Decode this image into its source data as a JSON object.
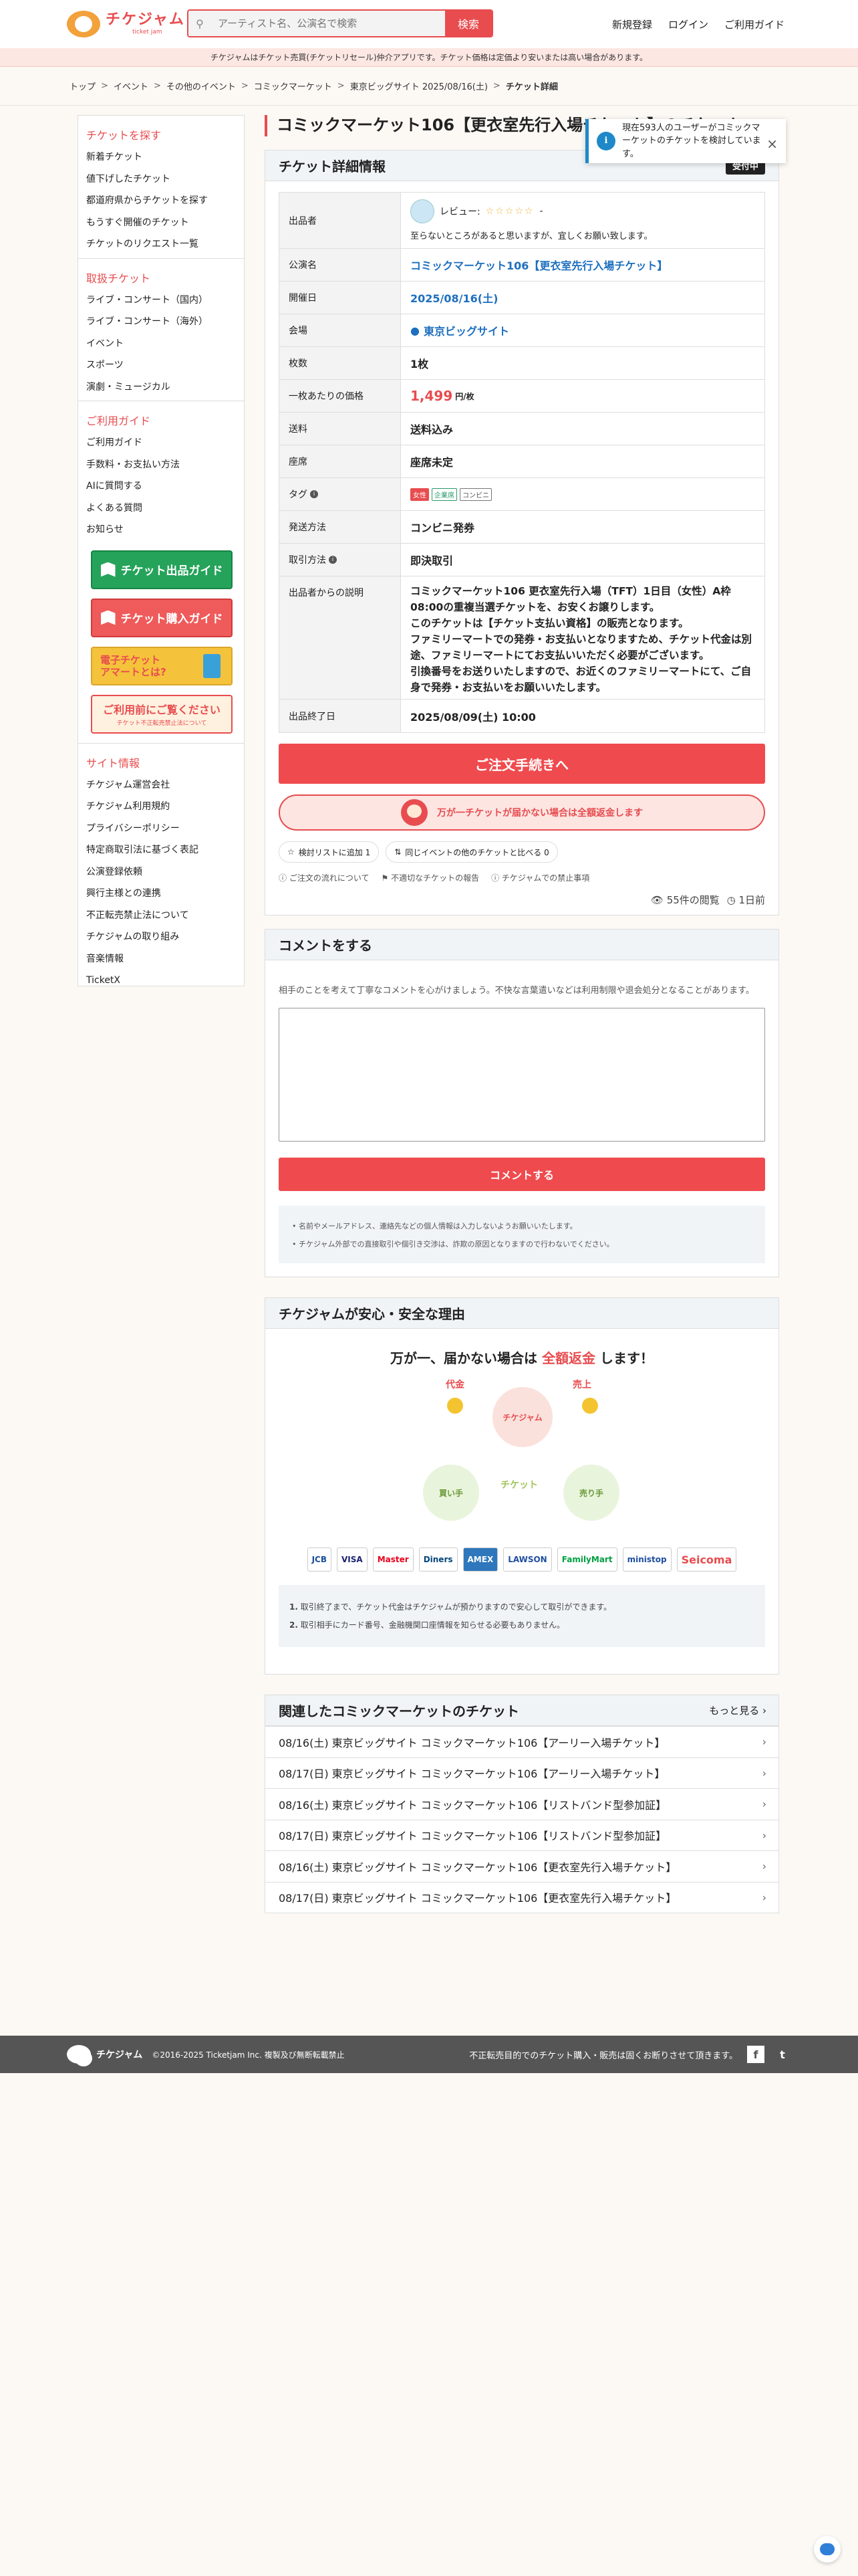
{
  "header": {
    "logo_title": "チケジャム",
    "logo_sub": "ticket jam",
    "search_placeholder": "アーティスト名、公演名で検索",
    "search_button": "検索",
    "nav": [
      "新規登録",
      "ログイン",
      "ご利用ガイド"
    ]
  },
  "notice": "チケジャムはチケット売買(チケットリセール)仲介アプリです。チケット価格は定価より安いまたは高い場合があります。",
  "breadcrumb": [
    "トップ",
    "イベント",
    "その他のイベント",
    "コミックマーケット",
    "東京ビッグサイト 2025/08/16(土)",
    "チケット詳細"
  ],
  "breadcrumb_sep": ">",
  "sidebar": {
    "sections": [
      {
        "title": "チケットを探す",
        "items": [
          "新着チケット",
          "値下げしたチケット",
          "都道府県からチケットを探す",
          "もうすぐ開催のチケット",
          "チケットのリクエスト一覧"
        ]
      },
      {
        "title": "取扱チケット",
        "items": [
          "ライブ・コンサート（国内）",
          "ライブ・コンサート（海外）",
          "イベント",
          "スポーツ",
          "演劇・ミュージカル"
        ]
      },
      {
        "title": "ご利用ガイド",
        "items": [
          "ご利用ガイド",
          "手数料・お支払い方法",
          "AIに質問する",
          "よくある質問",
          "お知らせ"
        ]
      }
    ],
    "banners": {
      "sell": "チケット出品ガイド",
      "buy": "チケット購入ガイド",
      "e_ticket_line1": "電子チケット",
      "e_ticket_line2": "アマートとは?",
      "before_use": "ご利用前にご覧ください",
      "before_use_sub": "チケット不正転売禁止法について"
    },
    "site_info": {
      "title": "サイト情報",
      "items": [
        "チケジャム運営会社",
        "チケジャム利用規約",
        "プライバシーポリシー",
        "特定商取引法に基づく表記",
        "公演登録依頼",
        "興行主様との連携",
        "不正転売禁止法について",
        "チケジャムの取り組み",
        "音楽情報",
        "TicketX"
      ]
    }
  },
  "title": "コミックマーケット106【更衣室先行入場チケット】のチケット",
  "toast": {
    "text": "現在593人のユーザーがコミックマーケットのチケットを検討しています。",
    "close": "×",
    "icon": "i"
  },
  "detail": {
    "heading": "チケット詳細情報",
    "badge": "受付中",
    "seller": {
      "label": "出品者",
      "review_label": "レビュー:",
      "stars": "☆☆☆☆☆",
      "review_count": "-",
      "message": "至らないところがあると思いますが、宜しくお願い致します。"
    },
    "rows": [
      {
        "k": "公演名",
        "v": "コミックマーケット106【更衣室先行入場チケット】"
      },
      {
        "k": "開催日",
        "v": "2025/08/16(土)"
      },
      {
        "k": "会場",
        "v": "東京ビッグサイト"
      },
      {
        "k": "枚数",
        "v": "1枚"
      },
      {
        "k": "一枚あたりの価格",
        "v": "1,499",
        "unit": "円/枚"
      },
      {
        "k": "送料",
        "v": "送料込み"
      },
      {
        "k": "座席",
        "v": "座席未定"
      },
      {
        "k": "タグ",
        "tags": [
          "女性",
          "企業席",
          "コンビニ"
        ]
      },
      {
        "k": "発送方法",
        "v": "コンビニ発券"
      },
      {
        "k": "取引方法",
        "v": "即決取引"
      },
      {
        "k": "出品者からの説明",
        "v": "コミックマーケット106 更衣室先行入場（TFT）1日目（女性）A枠 08:00の重複当選チケットを、お安くお譲りします。\nこのチケットは【チケット支払い資格】の販売となります。\nファミリーマートでの発券・お支払いとなりますため、チケット代金は別途、ファミリーマートにてお支払いいただく必要がございます。\n引換番号をお送りいたしますので、お近くのファミリーマートにて、ご自身で発券・お支払いをお願いいたします。"
      },
      {
        "k": "出品終了日",
        "v": "2025/08/09(土) 10:00"
      }
    ],
    "info_icon": "i",
    "order_button": "ご注文手続きへ",
    "refund_text": "万が一チケットが届かない場合は全額返金します",
    "chips": [
      "検討リストに追加 1",
      "同じイベントの他のチケットと比べる 0"
    ],
    "links": [
      "ご注文の流れについて",
      "不適切なチケットの報告",
      "チケジャムでの禁止事項"
    ],
    "views": "55件の閲覧",
    "posted": "1日前"
  },
  "comment": {
    "heading": "コメントをする",
    "note": "相手のことを考えて丁寧なコメントを心がけましょう。不快な言葉遣いなどは利用制限や退会処分となることがあります。",
    "button": "コメントする",
    "rules": [
      "名前やメールアドレス、連絡先などの個人情報は入力しないようお願いいたします。",
      "チケジャム外部での直接取引や個引き交渉は、詐欺の原因となりますので行わないでください。"
    ]
  },
  "safety": {
    "heading": "チケジャムが安心・安全な理由",
    "headline_pre": "万が一、届かない場合は",
    "headline_em": "全額返金",
    "headline_post": "します！",
    "diagram_labels": {
      "left_top": "代金",
      "right_top": "売上",
      "center": "チケット",
      "left": "買い手",
      "right": "売り手",
      "hub": "チケジャム"
    },
    "payments": [
      "JCB",
      "VISA",
      "Master",
      "Diners",
      "AMEX",
      "LAWSON",
      "FamilyMart",
      "ministop",
      "Seicoma"
    ],
    "points": [
      "取引終了まで、チケット代金はチケジャムが預かりますので安心して取引ができます。",
      "取引相手にカード番号、金融機関口座情報を知らせる必要もありません。"
    ]
  },
  "related": {
    "heading": "関連したコミックマーケットのチケット",
    "more": "もっと見る",
    "items": [
      "08/16(土) 東京ビッグサイト コミックマーケット106【アーリー入場チケット】",
      "08/17(日) 東京ビッグサイト コミックマーケット106【アーリー入場チケット】",
      "08/16(土) 東京ビッグサイト コミックマーケット106【リストバンド型参加証】",
      "08/17(日) 東京ビッグサイト コミックマーケット106【リストバンド型参加証】",
      "08/16(土) 東京ビッグサイト コミックマーケット106【更衣室先行入場チケット】",
      "08/17(日) 東京ビッグサイト コミックマーケット106【更衣室先行入場チケット】"
    ]
  },
  "footer": {
    "copyright": "©2016-2025 Ticketjam Inc. 複製及び無断転載禁止",
    "message": "不正転売目的でのチケット購入・販売は固くお断りさせて頂きます。",
    "facebook": "f",
    "twitter": "t"
  },
  "colors": {
    "accent": "#e84c4f",
    "link": "#1e6fbf",
    "info": "#1e88c8"
  }
}
